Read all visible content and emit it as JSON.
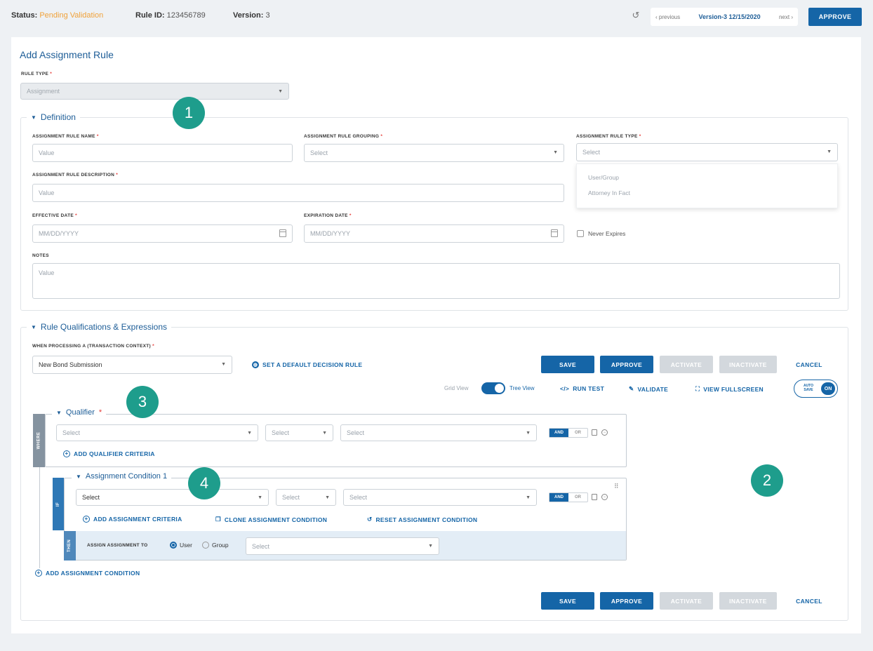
{
  "topbar": {
    "status_label": "Status:",
    "status_value": "Pending Validation",
    "rule_id_label": "Rule ID:",
    "rule_id_value": "123456789",
    "version_label": "Version:",
    "version_value": "3",
    "prev_label": "previous",
    "current_version": "Version-3 12/15/2020",
    "next_label": "next",
    "approve_label": "APPROVE"
  },
  "page_title": "Add Assignment Rule",
  "rule_type": {
    "label": "RULE TYPE",
    "value": "Assignment"
  },
  "definition": {
    "legend": "Definition",
    "name_label": "ASSIGNMENT RULE NAME",
    "name_placeholder": "Value",
    "grouping_label": "ASSIGNMENT RULE GROUPING",
    "grouping_placeholder": "Select",
    "type_label": "ASSIGNMENT RULE TYPE",
    "type_placeholder": "Select",
    "type_options": [
      "User/Group",
      "Attorney In Fact"
    ],
    "description_label": "ASSIGNMENT RULE DESCRIPTION",
    "description_placeholder": "Value",
    "effective_label": "EFFECTIVE DATE",
    "effective_placeholder": "MM/DD/YYYY",
    "expiration_label": "EXPIRATION DATE",
    "expiration_placeholder": "MM/DD/YYYY",
    "never_expires": "Never Expires",
    "notes_label": "NOTES",
    "notes_placeholder": "Value"
  },
  "qualifications": {
    "legend": "Rule Qualifications & Expressions",
    "context_label": "WHEN PROCESSING A (TRANSACTION CONTEXT)",
    "context_value": "New Bond Submission",
    "default_rule": "SET A DEFAULT DECISION RULE",
    "save": "SAVE",
    "approve": "APPROVE",
    "activate": "ACTIVATE",
    "inactivate": "INACTIVATE",
    "cancel": "CANCEL",
    "grid_view": "Grid View",
    "tree_view": "Tree View",
    "run_test": "RUN TEST",
    "validate": "VALIDATE",
    "view_fullscreen": "VIEW FULLSCREEN",
    "auto_save": "AUTO SAVE",
    "auto_save_state": "ON"
  },
  "qualifier": {
    "legend": "Qualifier",
    "side": "WHERE",
    "select1": "Select",
    "select2": "Select",
    "select3": "Select",
    "and": "AND",
    "or": "OR",
    "add_criteria": "ADD QUALIFIER CRITERIA"
  },
  "condition": {
    "legend": "Assignment Condition 1",
    "side_if": "IF",
    "side_then": "THEN",
    "select1": "Select",
    "select2": "Select",
    "select3": "Select",
    "and": "AND",
    "or": "OR",
    "add_criteria": "ADD ASSIGNMENT CRITERIA",
    "clone": "CLONE ASSIGNMENT CONDITION",
    "reset": "RESET ASSIGNMENT CONDITION",
    "assign_to": "ASSIGN ASSIGNMENT TO",
    "opt_user": "User",
    "opt_group": "Group",
    "assign_select": "Select"
  },
  "add_condition": "ADD ASSIGNMENT CONDITION",
  "badges": [
    "1",
    "2",
    "3",
    "4"
  ]
}
